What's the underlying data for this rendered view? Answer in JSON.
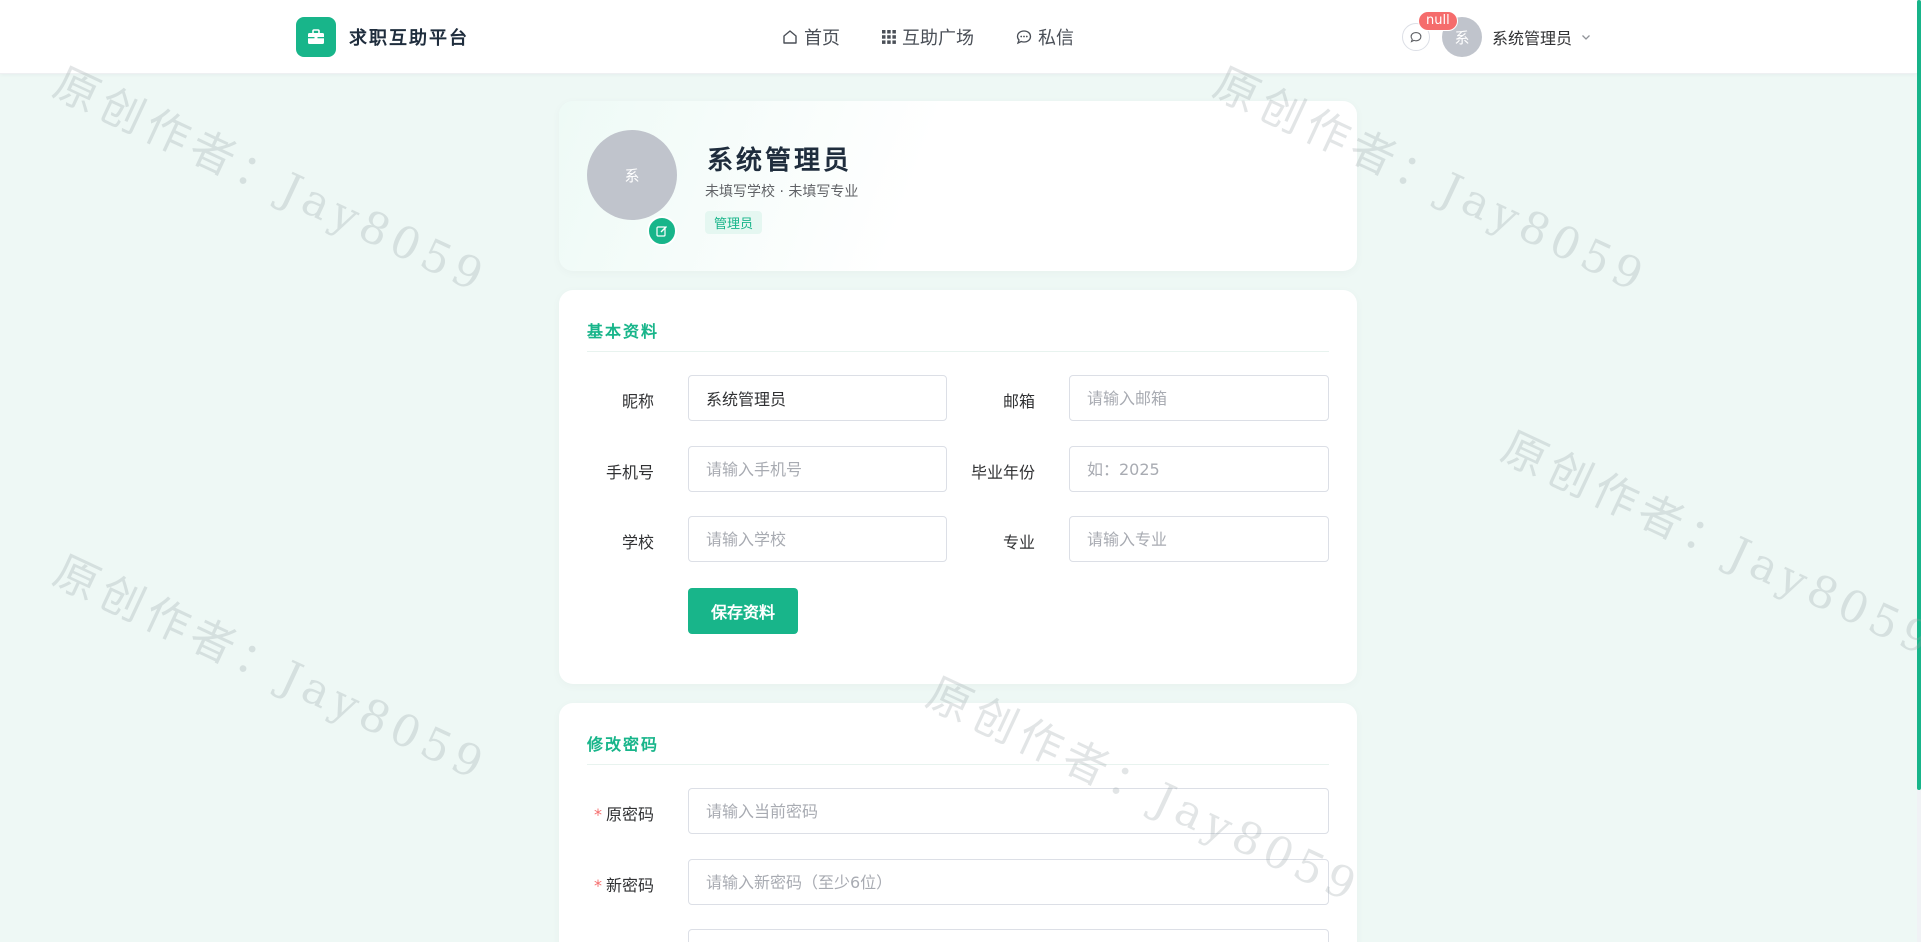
{
  "app": {
    "name": "求职互助平台"
  },
  "nav": [
    {
      "label": "首页",
      "icon": "home-icon"
    },
    {
      "label": "互助广场",
      "icon": "grid-icon"
    },
    {
      "label": "私信",
      "icon": "chat-icon"
    }
  ],
  "header": {
    "badge": "null",
    "avatar_text": "系",
    "user_name": "系统管理员"
  },
  "profile": {
    "avatar_text": "系",
    "name": "系统管理员",
    "subtitle": "未填写学校 · 未填写专业",
    "role_tag": "管理员"
  },
  "basic": {
    "title": "基本资料",
    "fields": {
      "nickname": {
        "label": "昵称",
        "value": "系统管理员",
        "placeholder": ""
      },
      "email": {
        "label": "邮箱",
        "value": "",
        "placeholder": "请输入邮箱"
      },
      "phone": {
        "label": "手机号",
        "value": "",
        "placeholder": "请输入手机号"
      },
      "grad_year": {
        "label": "毕业年份",
        "value": "",
        "placeholder": "如：2025"
      },
      "school": {
        "label": "学校",
        "value": "",
        "placeholder": "请输入学校"
      },
      "major": {
        "label": "专业",
        "value": "",
        "placeholder": "请输入专业"
      }
    },
    "save_label": "保存资料"
  },
  "password": {
    "title": "修改密码",
    "required_mark": "*",
    "old": {
      "label": "原密码",
      "placeholder": "请输入当前密码"
    },
    "new": {
      "label": "新密码",
      "placeholder": "请输入新密码（至少6位）"
    }
  },
  "watermark": "原创作者：Jay8059",
  "colors": {
    "primary": "#18b58a",
    "badge": "#f56c6c",
    "background": "#eef8f5"
  }
}
